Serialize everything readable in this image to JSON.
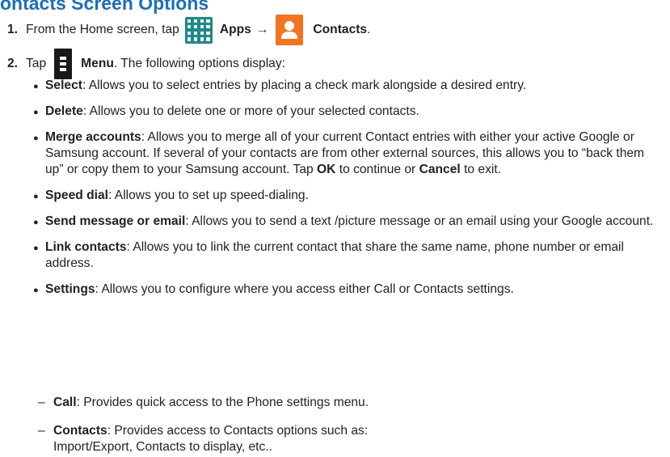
{
  "title": "ontacts Screen Options",
  "steps": [
    {
      "num": "1.",
      "pre": "From the Home screen, tap",
      "apps_label": "Apps",
      "arrow": "→",
      "contacts_label": "Contacts",
      "end": "."
    },
    {
      "num": "2.",
      "pre": "Tap",
      "menu_label": "Menu",
      "post": ". The following options display:"
    }
  ],
  "icons": {
    "apps": "apps-grid-icon",
    "contacts": "contacts-person-icon",
    "menu": "menu-dots-icon"
  },
  "colors": {
    "title": "#1b6fc2",
    "apps_icon": "#1a8a8c",
    "contacts_icon": "#f47321",
    "menu_icon": "#1a1a1a"
  },
  "options": [
    {
      "label": "Select",
      "text": ": Allows you to select entries by placing a check mark alongside a desired entry."
    },
    {
      "label": "Delete",
      "text": ": Allows you to delete one or more of your selected contacts."
    },
    {
      "label": "Merge accounts",
      "text": ": Allows you to merge all of your current Contact entries with either your active Google or Samsung account. If several of your contacts are from other external sources, this allows you to “back them up” or copy them to your Samsung account. Tap ",
      "ok": "OK",
      "mid": " to continue or ",
      "cancel": "Cancel",
      "end": " to exit."
    },
    {
      "label": "Speed dial",
      "text": ": Allows you to set up speed-dialing."
    },
    {
      "label": "Send message or email",
      "text": ": Allows you to send a text /picture message or an email using your Google account."
    },
    {
      "label": "Link contacts",
      "text": ": Allows you to link the current contact that share the same name, phone number or email address."
    },
    {
      "label": "Settings",
      "text": ": Allows you to configure where you access either Call or Contacts settings."
    }
  ],
  "sub_options": [
    {
      "dash": "–",
      "label": "Call",
      "text": ": Provides quick access to the Phone settings menu."
    },
    {
      "dash": "–",
      "label": "Contacts",
      "text": ": Provides access to Contacts options such as:",
      "cont": "Import/Export, Contacts to display, etc.."
    }
  ]
}
